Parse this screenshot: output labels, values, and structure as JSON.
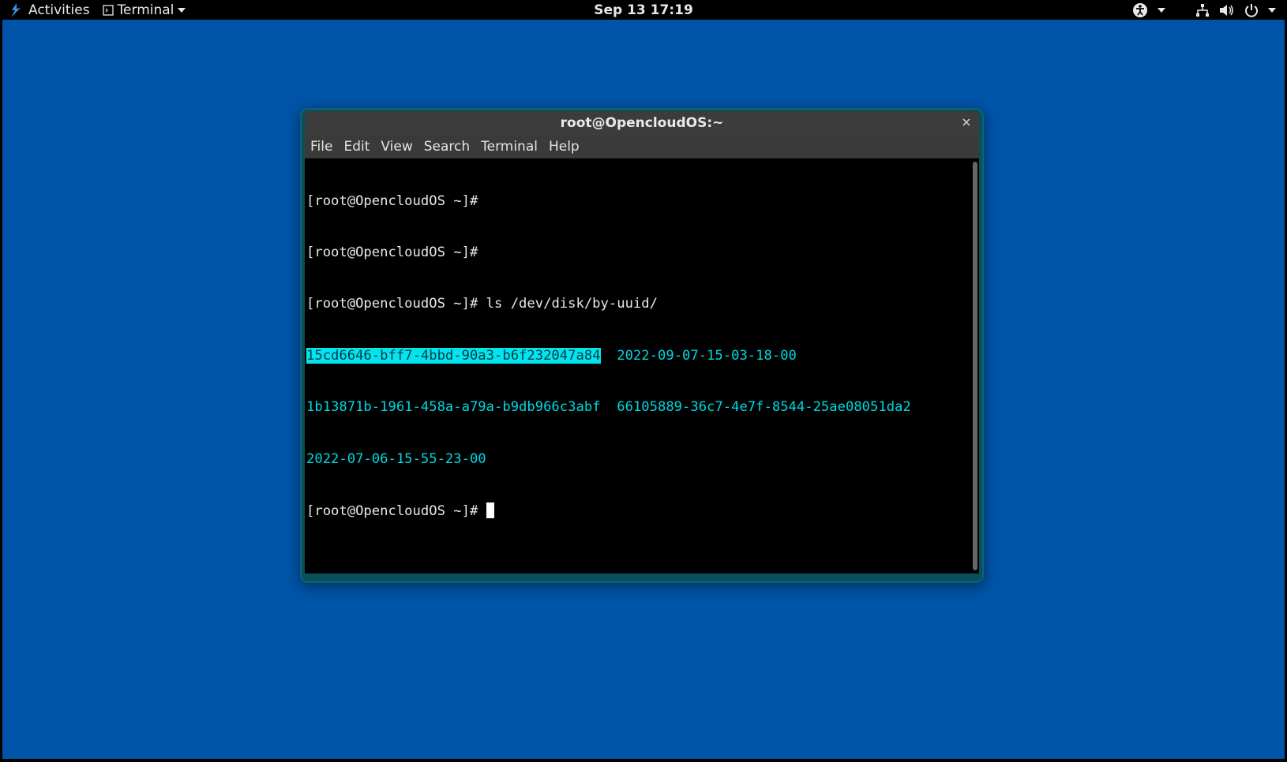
{
  "topbar": {
    "activities_label": "Activities",
    "app_menu_label": "Terminal",
    "clock": "Sep 13  17:19",
    "icons": [
      "accessibility-icon",
      "network-icon",
      "volume-icon",
      "power-icon"
    ]
  },
  "window": {
    "title": "root@OpencloudOS:~",
    "close_symbol": "×",
    "menu": [
      "File",
      "Edit",
      "View",
      "Search",
      "Terminal",
      "Help"
    ]
  },
  "terminal": {
    "prompt": "[root@OpencloudOS ~]# ",
    "command": "ls /dev/disk/by-uuid/",
    "ls_output": {
      "row1": [
        "15cd6646-bff7-4bbd-90a3-b6f232047a84",
        "2022-09-07-15-03-18-00"
      ],
      "row2": [
        "1b13871b-1961-458a-a79a-b9db966c3abf",
        "66105889-36c7-4e7f-8544-25ae08051da2"
      ],
      "row3": [
        "2022-07-06-15-55-23-00"
      ]
    }
  },
  "colors": {
    "desktop": "#0054a8",
    "terminal_bg": "#000000",
    "ls_entry": "#00d7e0",
    "selection": "#00e5ee"
  }
}
